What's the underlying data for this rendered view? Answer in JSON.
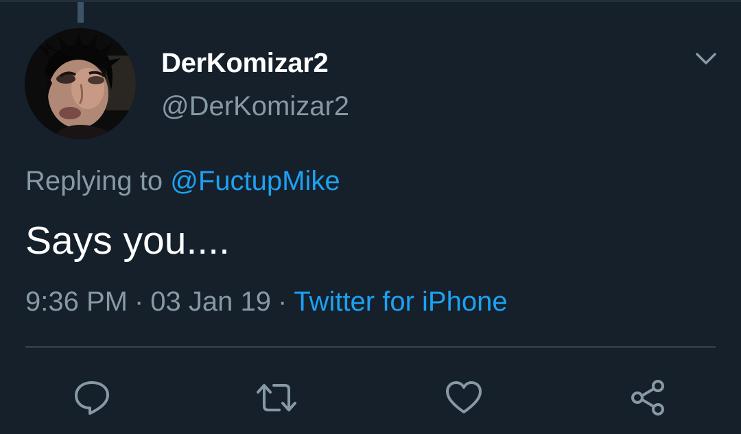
{
  "tweet": {
    "display_name": "DerKomizar2",
    "handle": "@DerKomizar2",
    "replying_prefix": "Replying to ",
    "replying_to": "@FuctupMike",
    "text": "Says you....",
    "time": "9:36 PM",
    "date": "03 Jan 19",
    "separator": "·",
    "source": "Twitter for iPhone"
  },
  "icons": {
    "menu": "chevron-down-icon",
    "reply": "reply-icon",
    "retweet": "retweet-icon",
    "like": "heart-icon",
    "share": "share-icon"
  },
  "colors": {
    "background": "#15202b",
    "text_primary": "#ffffff",
    "text_secondary": "#8899a6",
    "link": "#1da1f2",
    "divider": "#38444d"
  }
}
